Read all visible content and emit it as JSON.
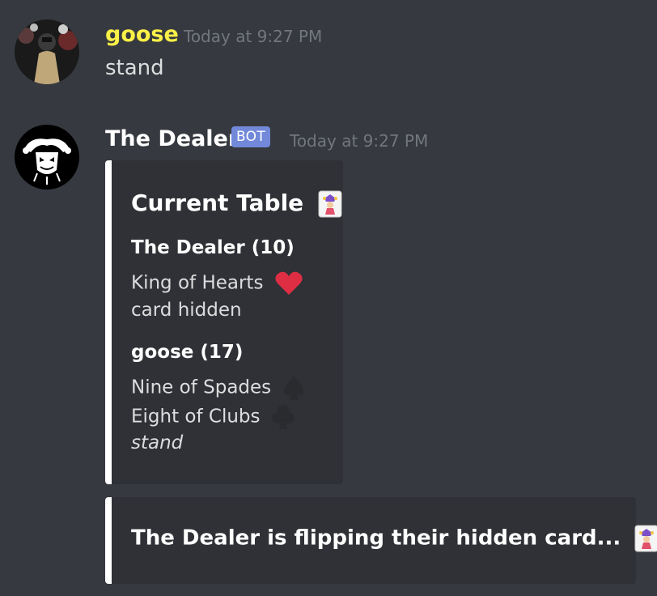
{
  "messages": [
    {
      "username": "goose",
      "username_color": "#f9f048",
      "timestamp": "Today at 9:27 PM",
      "text": "stand",
      "avatar_icon": "user-photo-avatar"
    },
    {
      "username": "The Dealer",
      "username_color": "#ffffff",
      "bot_tag": "BOT",
      "timestamp": "Today at 9:27 PM",
      "avatar_icon": "jester-avatar",
      "embeds": [
        {
          "title": "Current Table",
          "title_icon": "joker-emoji-icon",
          "fields": [
            {
              "name": "The Dealer (10)",
              "lines": [
                "King of Hearts",
                "card hidden"
              ],
              "line_icons": [
                "heart-icon",
                ""
              ]
            },
            {
              "name": "goose (17)",
              "lines": [
                "Nine of Spades",
                "Eight of Clubs",
                "stand"
              ],
              "line_icons": [
                "spade-icon",
                "club-icon",
                ""
              ]
            }
          ]
        },
        {
          "title": "The Dealer is flipping their hidden card...",
          "title_icon": "joker-emoji-icon"
        }
      ]
    }
  ],
  "colors": {
    "background": "#36393f",
    "embed_background": "#2f3136",
    "embed_border": "#ffffff",
    "bot_tag": "#7289da",
    "timestamp": "#72767d",
    "heart": "#dd2e44"
  }
}
